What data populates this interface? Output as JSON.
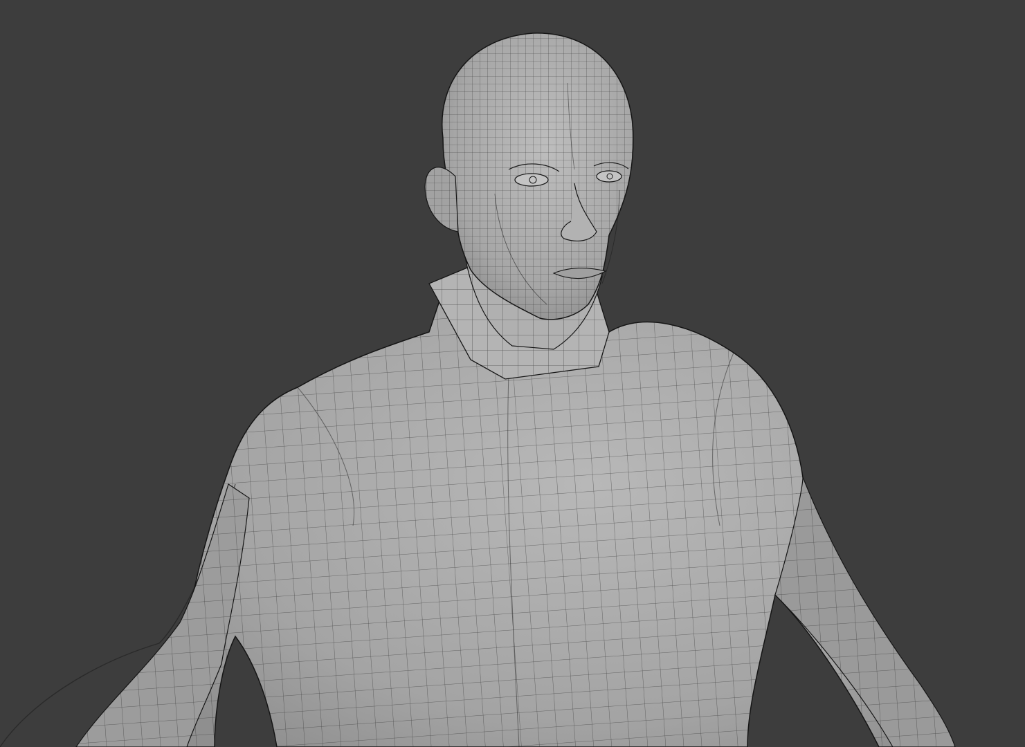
{
  "viewport": {
    "background_color": "#3d3d3d",
    "mesh_fill_color": "#a8a8a8",
    "wire_color": "#1a1a1a",
    "shading": "solid",
    "overlay": "wireframe"
  },
  "scene": {
    "object": "male-character-base-mesh",
    "visible_parts": [
      "head",
      "ears",
      "eyes",
      "nose",
      "mouth",
      "neck",
      "collar",
      "torso",
      "left-arm",
      "right-arm"
    ]
  }
}
